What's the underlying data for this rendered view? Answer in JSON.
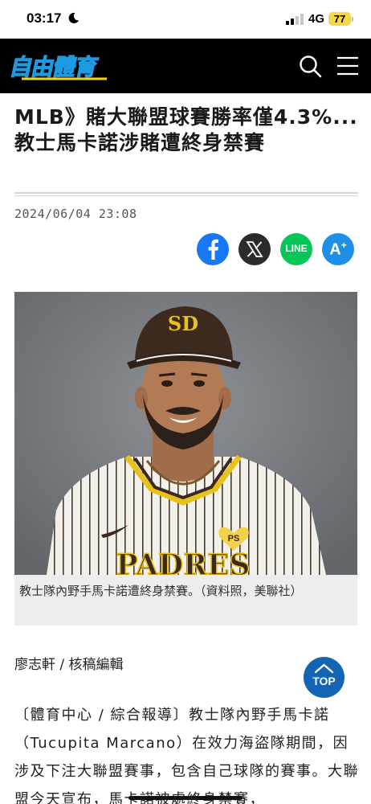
{
  "status_bar": {
    "time": "03:17",
    "network": "4G",
    "battery": "77"
  },
  "header": {
    "logo_text": "自由體育"
  },
  "article": {
    "title": "MLB》賭大聯盟球賽勝率僅4.3%... 教士馬卡諾涉賭遭終身禁賽",
    "date": "2024/06/04 23:08",
    "share": {
      "line_label": "LINE",
      "font_label": "A",
      "font_sup": "+"
    },
    "photo": {
      "caption": "教士隊內野手馬卡諾遭終身禁賽。（資料照，美聯社）"
    },
    "byline": "廖志軒 / 核稿編輯",
    "body": "〔體育中心 / 綜合報導〕教士隊內野手馬卡諾（Tucupita Marcano）在效力海盜隊期間，因涉及下注大聯盟賽事，包含自己球隊的賽事。大聯盟今天宣布，馬卡諾被處終身禁賽，"
  },
  "top_button": {
    "label": "TOP"
  },
  "colors": {
    "nav_bg": "#000000",
    "logo_blue": "#1e9be0",
    "logo_yellow": "#f5d400",
    "facebook": "#1877f2",
    "x": "#2b2b2b",
    "line": "#06c755",
    "font_size": "#1e8fe6",
    "top_button": "#1464b4"
  },
  "icons": [
    "moon-icon",
    "signal-icon",
    "search-icon",
    "menu-icon",
    "facebook-icon",
    "x-icon",
    "line-icon",
    "font-size-icon",
    "top-arrow-icon"
  ]
}
